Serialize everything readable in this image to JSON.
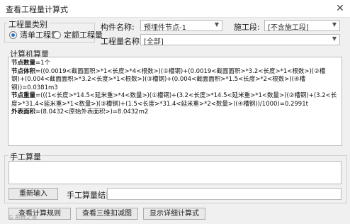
{
  "window": {
    "title": "查看工程量计算式",
    "close_glyph": "✕"
  },
  "qty_type": {
    "label": "工程量类别",
    "options": [
      "清单工程量",
      "定额工程量"
    ],
    "selected": 0
  },
  "component": {
    "label": "构件名称:",
    "value": "预埋件节点-1"
  },
  "construction": {
    "label": "施工段:",
    "value": "[不含施工段]"
  },
  "formula_name": {
    "label": "工程量名称:",
    "value": "[全部]"
  },
  "calc": {
    "label": "计算机算量",
    "lines": [
      {
        "name": "节点数量",
        "text": "=1个"
      },
      {
        "name": "节点体积",
        "text": "=((0.0019<截面面积>*1<长度>*4<根数>)(①槽钢)+(0.0019<截面面积>*3.2<长度>*1<根数>)(②槽钢)+(0.004<截面面积>*3.2<长度>*1<根数>)(③槽钢)+(0.004<截面面积>*1.5<长度>*2<根数>)(④槽钢))=0.0381m3"
      },
      {
        "name": "节点重量",
        "text": "=(((1<长度>*14.5<延米重>*4<数量>)(①槽钢)+(3.2<长度>*14.5<延米重>*1<数量>)(②槽钢)+(3.2<长度>*31.4<延米重>*1<数量>)(③槽钢)+(1.5<长度>*31.4<延米重>*2<数量>)(④槽钢))/1000)=0.2991t"
      },
      {
        "name": "外表面积",
        "text": "=(8.0432<原始外表面积>)=8.0432m2"
      }
    ]
  },
  "manual": {
    "label": "手工算量",
    "reenter_button": "重新输入",
    "result_label": "手工算量结果=",
    "result_value": ""
  },
  "footer": {
    "buttons": [
      "查看计算规则",
      "查看三维扣减图",
      "显示详细计算式"
    ],
    "watermark": "G 系统之家"
  }
}
